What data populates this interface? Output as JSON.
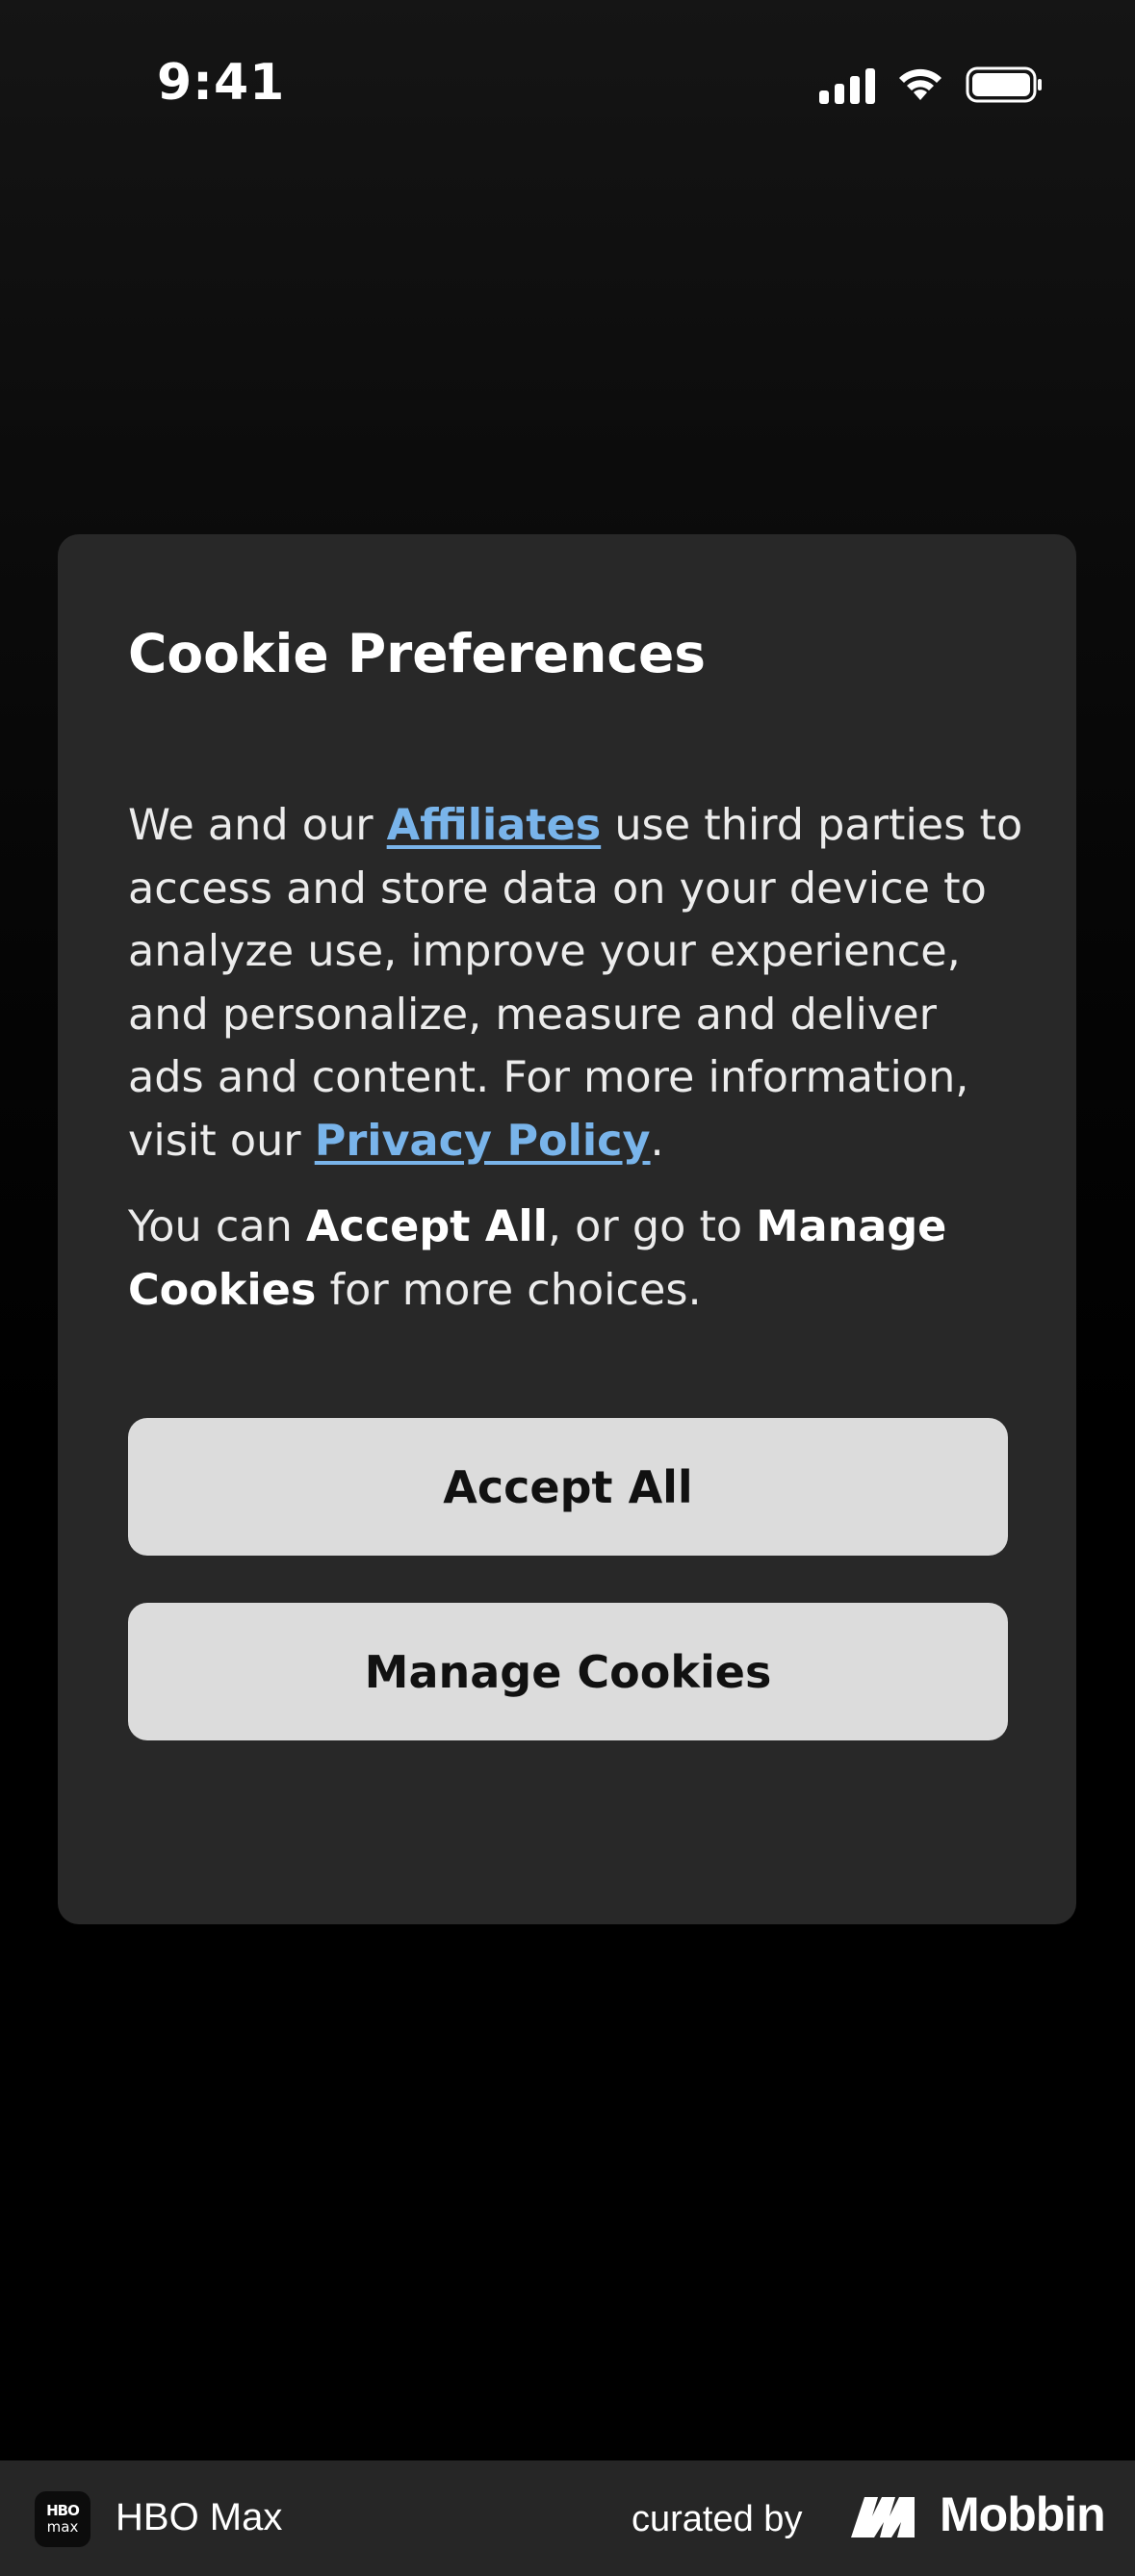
{
  "status_bar": {
    "time": "9:41",
    "icons": [
      "cellular-signal-icon",
      "wifi-icon",
      "battery-icon"
    ]
  },
  "dialog": {
    "title": "Cookie Preferences",
    "body1": {
      "before_link": "We and our ",
      "affiliates_link": "Affiliates",
      "middle": " use third parties to access and store data on your device to analyze use, improve your experience, and personalize, measure and deliver ads and content. For more information, visit our ",
      "privacy_link": "Privacy Policy",
      "end": "."
    },
    "body2": {
      "p1": "You can ",
      "accept_bold": "Accept All",
      "p2": ", or go to ",
      "manage_bold": "Manage Cookies",
      "p3": " for more choices."
    },
    "accept_label": "Accept All",
    "manage_label": "Manage Cookies"
  },
  "footer": {
    "app_icon_line1": "HBO",
    "app_icon_line2": "max",
    "app_name": "HBO Max",
    "curated_by": "curated by",
    "brand": "Mobbin"
  },
  "colors": {
    "dialog_bg": "#282828",
    "link": "#79b4ea",
    "button_bg": "#dcdcdc",
    "footer_bg": "#262626"
  }
}
